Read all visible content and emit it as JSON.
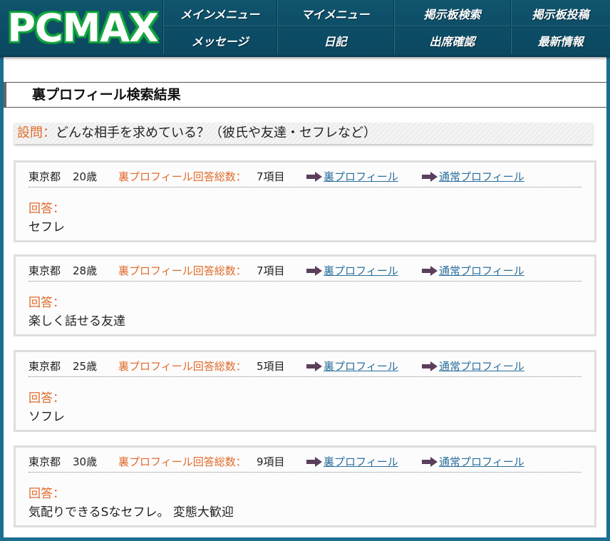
{
  "header": {
    "logo": "PCMAX",
    "nav": [
      {
        "label": "メインメニュー"
      },
      {
        "label": "マイメニュー"
      },
      {
        "label": "掲示板検索"
      },
      {
        "label": "掲示板投稿"
      },
      {
        "label": "メッセージ"
      },
      {
        "label": "日記"
      },
      {
        "label": "出席確認"
      },
      {
        "label": "最新情報"
      }
    ]
  },
  "page_title": "裏プロフィール検索結果",
  "question": {
    "label": "設問：",
    "text": "どんな相手を求めている？（彼氏や友達・セフレなど）"
  },
  "results": [
    {
      "location": "東京都",
      "age": "20歳",
      "count_label": "裏プロフィール回答総数：",
      "count": "7項目",
      "link_ura": "裏プロフィール",
      "link_std": "通常プロフィール",
      "answer_label": "回答：",
      "answer": "セフレ"
    },
    {
      "location": "東京都",
      "age": "28歳",
      "count_label": "裏プロフィール回答総数：",
      "count": "7項目",
      "link_ura": "裏プロフィール",
      "link_std": "通常プロフィール",
      "answer_label": "回答：",
      "answer": "楽しく話せる友達"
    },
    {
      "location": "東京都",
      "age": "25歳",
      "count_label": "裏プロフィール回答総数：",
      "count": "5項目",
      "link_ura": "裏プロフィール",
      "link_std": "通常プロフィール",
      "answer_label": "回答：",
      "answer": "ソフレ"
    },
    {
      "location": "東京都",
      "age": "30歳",
      "count_label": "裏プロフィール回答総数：",
      "count": "9項目",
      "link_ura": "裏プロフィール",
      "link_std": "通常プロフィール",
      "answer_label": "回答：",
      "answer": "気配りできるSなセフレ。 変態大歓迎"
    }
  ],
  "colors": {
    "header_bg": "#0b4760",
    "frame": "#1a6f91",
    "accent_orange": "#e06a2a",
    "link": "#2a6e9c",
    "logo_green": "#13b44a"
  },
  "icons": {
    "arrow": "right-arrow-icon"
  }
}
